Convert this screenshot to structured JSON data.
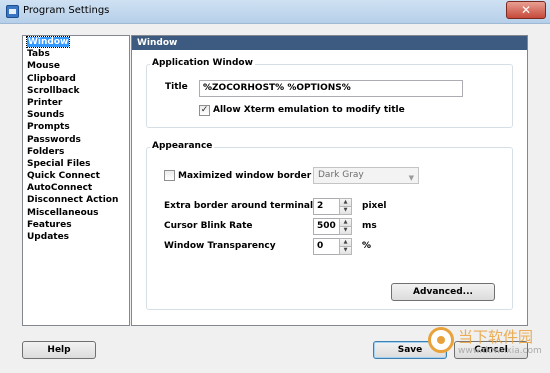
{
  "window": {
    "title": "Program Settings",
    "close_glyph": "✕",
    "icon": "app-icon"
  },
  "sidebar": {
    "items": [
      {
        "label": "Window",
        "selected": true
      },
      {
        "label": "Tabs"
      },
      {
        "label": "Mouse"
      },
      {
        "label": "Clipboard"
      },
      {
        "label": "Scrollback"
      },
      {
        "label": "Printer"
      },
      {
        "label": "Sounds"
      },
      {
        "label": "Prompts"
      },
      {
        "label": "Passwords"
      },
      {
        "label": "Folders"
      },
      {
        "label": "Special Files"
      },
      {
        "label": "Quick Connect"
      },
      {
        "label": "AutoConnect"
      },
      {
        "label": "Disconnect Action"
      },
      {
        "label": "Miscellaneous"
      },
      {
        "label": "Features"
      },
      {
        "label": "Updates"
      }
    ]
  },
  "panel": {
    "header": "Window",
    "app_window": {
      "group_title": "Application Window",
      "title_label": "Title",
      "title_value": "%ZOCORHOST% %OPTIONS%",
      "xterm_checked": true,
      "xterm_label": "Allow Xterm emulation to modify title"
    },
    "appearance": {
      "group_title": "Appearance",
      "maximized_checked": false,
      "maximized_label": "Maximized window border",
      "border_color": "Dark Gray",
      "extra_border_label": "Extra border around terminal",
      "extra_border_value": "2",
      "extra_border_unit": "pixel",
      "blink_label": "Cursor Blink Rate",
      "blink_value": "500",
      "blink_unit": "ms",
      "transparency_label": "Window Transparency",
      "transparency_value": "0",
      "transparency_unit": "%",
      "advanced_label": "Advanced..."
    }
  },
  "footer": {
    "help_label": "Help",
    "save_label": "Save",
    "cancel_label": "Cancel"
  },
  "watermark": {
    "text": "当下软件园",
    "url": "www.downxia.com"
  },
  "colors": {
    "panel_header": "#3d5a80",
    "selection": "#3399ff",
    "close": "#c7493a"
  }
}
